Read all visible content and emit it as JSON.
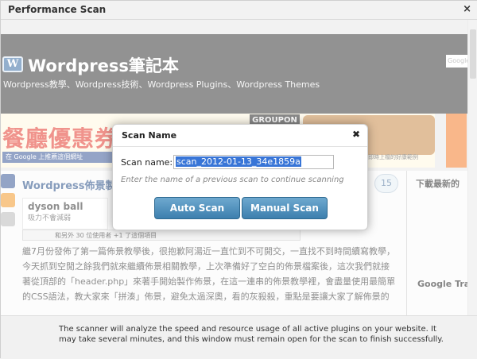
{
  "window": {
    "title": "Performance Scan",
    "close_icon": "×"
  },
  "site": {
    "title": "Wordpress筆記本",
    "subtitle": "Wordpress教學、Wordpress技術、Wordpress Plugins、Wordpress Themes",
    "search_placeholder": "Google",
    "banner_text": "餐廳優惠券",
    "banner_brand": "GROUPON",
    "share_text": "在 Google 上推薦這個網址",
    "share_right": "即時上檔的好康範例",
    "post_title": "Wordpress佈景製",
    "comment_count": "15",
    "sidebar_heading_1": "下載最新的",
    "sidebar_heading_2": "Google Tran",
    "ad_brand": "dyson ball",
    "ad_line": "吸力不會減弱",
    "fb_text": "和另外 30 位使用者 +1 了這個項目",
    "body_lines": [
      "繼7月份發佈了第一篇佈景教學後，很抱歉阿湯近一直忙到不可開交，一直找不到時間續寫教學，",
      "今天抓到空閒之餘我們就來繼續佈景相關教學，上次準備好了空白的佈景檔案後，這次我們就接",
      "著從頂部的「header.php」來著手開始製作佈景，在這一連串的佈景教學裡，會盡量使用最簡單",
      "的CSS語法，教大家來「拼湊」佈景，避免太過深奧，看的灰殺殺，重點是要讓大家了解佈景的"
    ]
  },
  "modal": {
    "title": "Scan Name",
    "close_icon": "✖",
    "scan_name_label": "Scan name:",
    "scan_name_value": "scan_2012-01-13_34e1859a",
    "hint": "Enter the name of a previous scan to continue scanning",
    "auto_scan_label": "Auto Scan",
    "manual_scan_label": "Manual Scan"
  },
  "footer": {
    "text": "The scanner will analyze the speed and resource usage of all active plugins on your website. It may take several minutes, and this window must remain open for the scan to finish successfully."
  },
  "colors": {
    "button": "#4a8bb8",
    "selection": "#3875d7",
    "header_bg": "#3a3a3a"
  }
}
